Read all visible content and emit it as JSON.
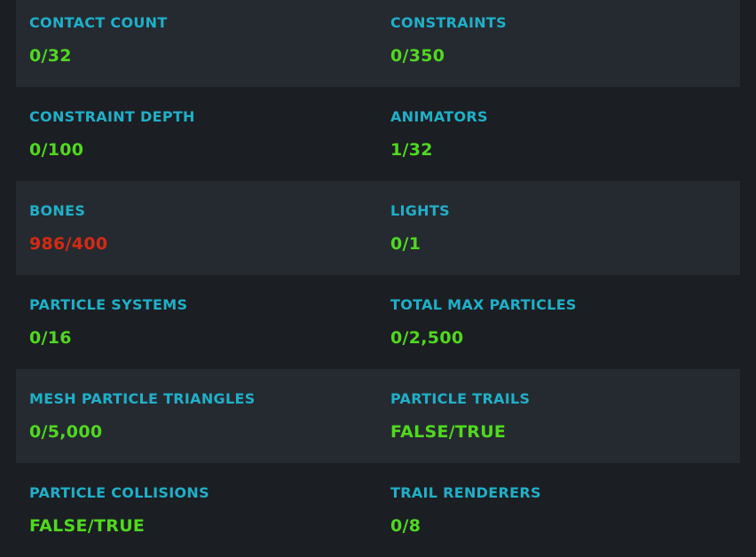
{
  "colors": {
    "label": "#1fb0c8",
    "value_ok": "#50d91e",
    "value_over": "#d42a12",
    "row_shaded": "#252a31",
    "background": "#1b1e23"
  },
  "rows": [
    {
      "left": {
        "label": "CONTACT COUNT",
        "value": "0/32",
        "status": "ok"
      },
      "right": {
        "label": "CONSTRAINTS",
        "value": "0/350",
        "status": "ok"
      }
    },
    {
      "left": {
        "label": "CONSTRAINT DEPTH",
        "value": "0/100",
        "status": "ok"
      },
      "right": {
        "label": "ANIMATORS",
        "value": "1/32",
        "status": "ok"
      }
    },
    {
      "left": {
        "label": "BONES",
        "value": "986/400",
        "status": "over"
      },
      "right": {
        "label": "LIGHTS",
        "value": "0/1",
        "status": "ok"
      }
    },
    {
      "left": {
        "label": "PARTICLE SYSTEMS",
        "value": "0/16",
        "status": "ok"
      },
      "right": {
        "label": "TOTAL MAX PARTICLES",
        "value": "0/2,500",
        "status": "ok"
      }
    },
    {
      "left": {
        "label": "MESH PARTICLE TRIANGLES",
        "value": "0/5,000",
        "status": "ok"
      },
      "right": {
        "label": "PARTICLE TRAILS",
        "value": "FALSE/TRUE",
        "status": "ok"
      }
    },
    {
      "left": {
        "label": "PARTICLE COLLISIONS",
        "value": "FALSE/TRUE",
        "status": "ok"
      },
      "right": {
        "label": "TRAIL RENDERERS",
        "value": "0/8",
        "status": "ok"
      }
    }
  ]
}
